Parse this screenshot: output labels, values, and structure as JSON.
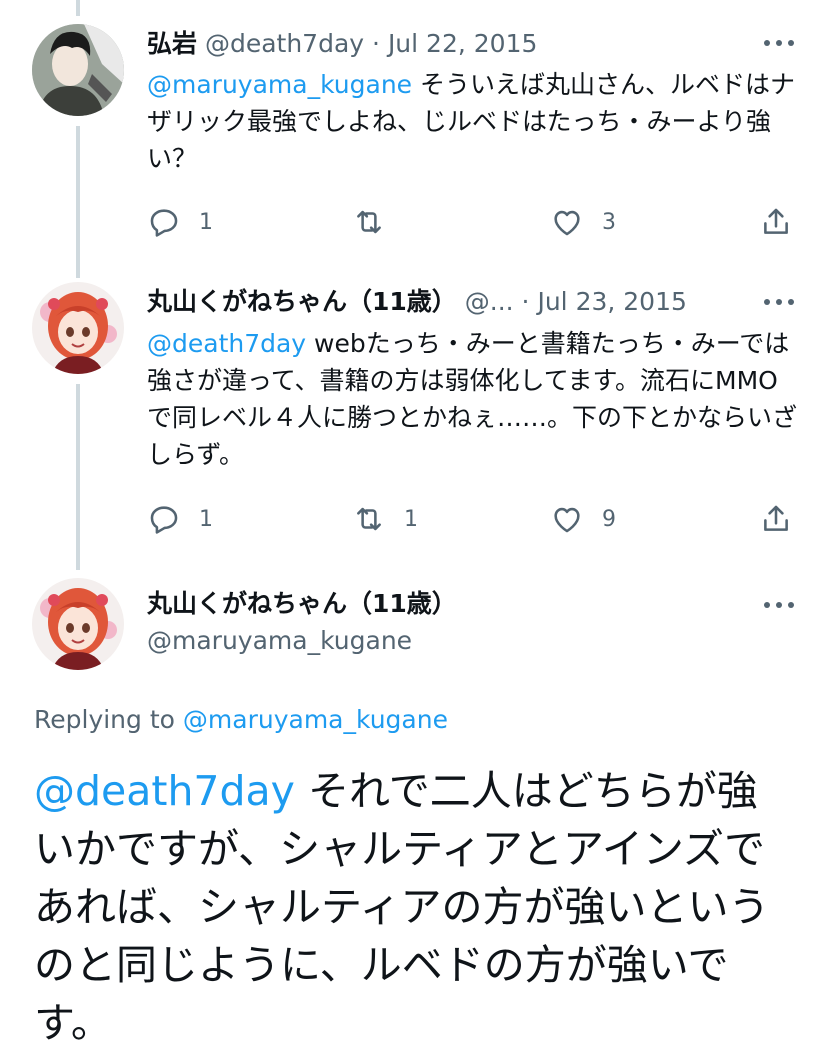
{
  "tweets": [
    {
      "display_name": "弘岩",
      "handle": "@death7day",
      "separator": "·",
      "date": "Jul 22, 2015",
      "mention": "@maruyama_kugane",
      "text": " そういえば丸山さん、ルベドはナザリック最強でしよね、じルベドはたっち・みーより強い？",
      "reply_count": "1",
      "retweet_count": "",
      "like_count": "3"
    },
    {
      "display_name": "丸山くがねちゃん（11歳）",
      "handle": "@...",
      "separator": "·",
      "date": "Jul 23, 2015",
      "mention": "@death7day",
      "text": " webたっち・みーと書籍たっち・みーでは強さが違って、書籍の方は弱体化してます。流石にMMOで同レベル４人に勝つとかねぇ……。下の下とかならいざしらず。",
      "reply_count": "1",
      "retweet_count": "1",
      "like_count": "9"
    }
  ],
  "main_tweet": {
    "display_name": "丸山くがねちゃん（11歳）",
    "handle": "@maruyama_kugane",
    "replying_label": "Replying to",
    "replying_to": "@maruyama_kugane",
    "mention": "@death7day",
    "text": " それで二人はどちらが強いかですが、シャルティアとアインズであれば、シャルティアの方が強いというのと同じように、ルベドの方が強いです。"
  },
  "colors": {
    "link": "#1d9bf0",
    "secondary": "#536471",
    "thread_line": "#cfd9de"
  },
  "icons": [
    "reply-icon",
    "retweet-icon",
    "like-icon",
    "share-icon",
    "more-icon"
  ]
}
